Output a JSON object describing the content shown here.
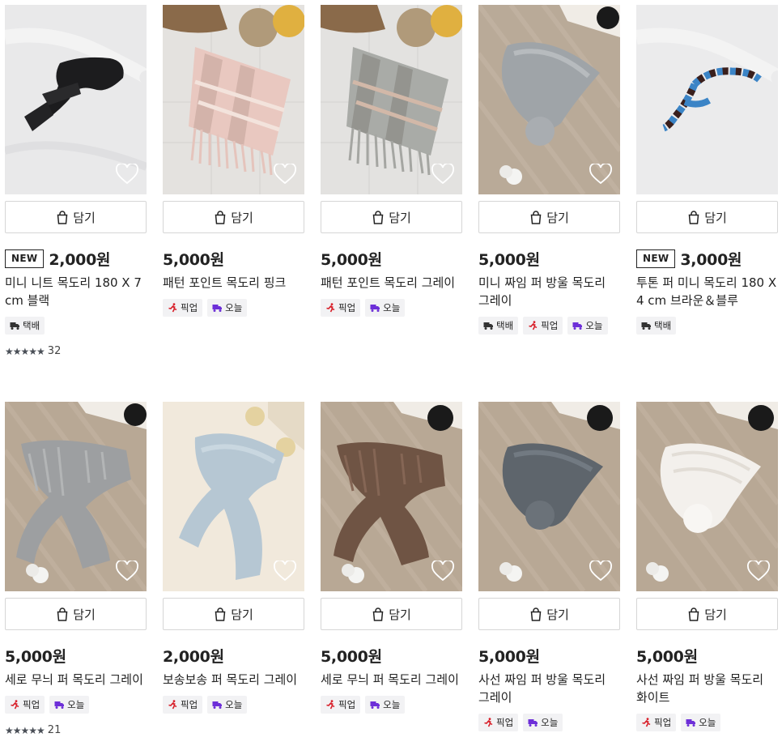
{
  "cart_label": "담기",
  "tag_labels": {
    "delivery": "택배",
    "pickup": "픽업",
    "today": "오늘"
  },
  "new_label": "NEW",
  "colors": {
    "badge_bg": "#f2f2f4",
    "pickup_red": "#d8202a",
    "today_purple": "#6d2fd8",
    "star": "#4a4f57"
  },
  "products": [
    {
      "name": "미니 니트 목도리 180 X 7 cm 블랙",
      "price": "2,000원",
      "is_new": true,
      "tags": [
        "delivery"
      ],
      "rating_count": "32",
      "stars": 4.5,
      "image": "black-knit-scarf"
    },
    {
      "name": "패턴 포인트 목도리 핑크",
      "price": "5,000원",
      "is_new": false,
      "tags": [
        "pickup",
        "today"
      ],
      "image": "pink-plaid-scarf"
    },
    {
      "name": "패턴 포인트 목도리 그레이",
      "price": "5,000원",
      "is_new": false,
      "tags": [
        "pickup",
        "today"
      ],
      "image": "gray-plaid-scarf"
    },
    {
      "name": "미니 짜임 퍼 방울 목도리 그레이",
      "price": "5,000원",
      "is_new": false,
      "tags": [
        "delivery",
        "pickup",
        "today"
      ],
      "image": "gray-fur-pompom-scarf"
    },
    {
      "name": "투톤 퍼 미니 목도리 180 X 4 cm 브라운＆블루",
      "price": "3,000원",
      "is_new": true,
      "tags": [
        "delivery"
      ],
      "image": "brown-blue-stripe-scarf"
    },
    {
      "name": "세로 무늬 퍼 목도리 그레이",
      "price": "5,000원",
      "is_new": false,
      "tags": [
        "pickup",
        "today"
      ],
      "rating_count": "21",
      "stars": 5,
      "image": "gray-ribbed-fur-scarf"
    },
    {
      "name": "보송보송 퍼 목도리 그레이",
      "price": "2,000원",
      "is_new": false,
      "tags": [
        "pickup",
        "today"
      ],
      "image": "light-blue-fur-scarf"
    },
    {
      "name": "세로 무늬 퍼 목도리 그레이",
      "price": "5,000원",
      "is_new": false,
      "tags": [
        "pickup",
        "today"
      ],
      "image": "brown-ribbed-fur-scarf"
    },
    {
      "name": "사선 짜임 퍼 방울 목도리 그레이",
      "price": "5,000원",
      "is_new": false,
      "tags": [
        "pickup",
        "today"
      ],
      "image": "slate-fur-pompom-scarf"
    },
    {
      "name": "사선 짜임 퍼 방울 목도리 화이트",
      "price": "5,000원",
      "is_new": false,
      "tags": [
        "pickup",
        "today"
      ],
      "image": "white-fur-pompom-scarf"
    }
  ]
}
